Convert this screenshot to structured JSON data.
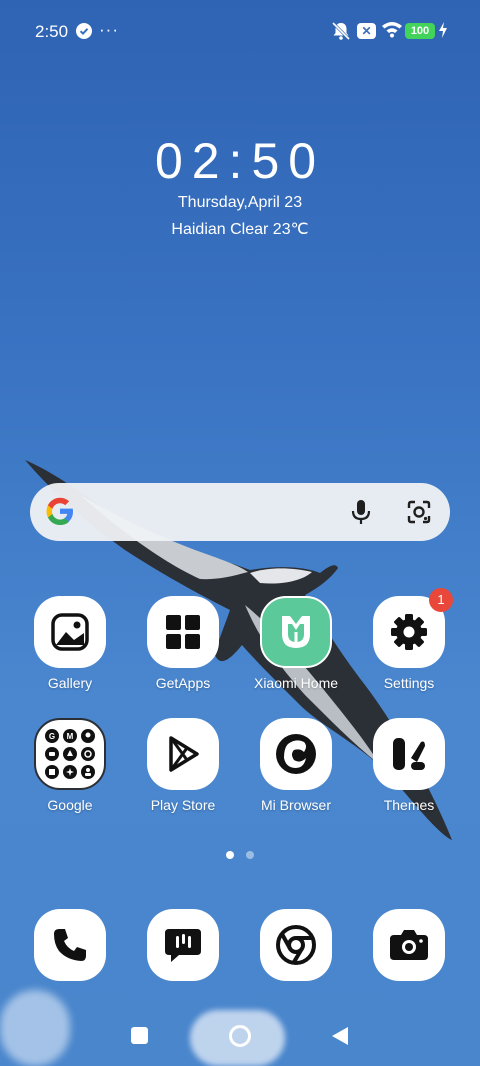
{
  "status_bar": {
    "time": "2:50",
    "more": "···",
    "sim_badge": "✕",
    "battery": "100"
  },
  "clock": {
    "time": "02:50",
    "date": "Thursday,April 23",
    "weather": "Haidian Clear 23℃"
  },
  "search": {
    "icons": [
      "google-logo",
      "mic-icon",
      "lens-icon"
    ]
  },
  "apps": [
    {
      "label": "Gallery",
      "icon": "gallery-icon"
    },
    {
      "label": "GetApps",
      "icon": "getapps-icon"
    },
    {
      "label": "Xiaomi Home",
      "icon": "xiaomi-home-icon"
    },
    {
      "label": "Settings",
      "icon": "gear-icon",
      "badge": "1"
    },
    {
      "label": "Google",
      "icon": "google-folder-icon"
    },
    {
      "label": "Play Store",
      "icon": "play-store-icon"
    },
    {
      "label": "Mi Browser",
      "icon": "mi-browser-icon"
    },
    {
      "label": "Themes",
      "icon": "themes-icon"
    }
  ],
  "dock": [
    {
      "icon": "phone-icon"
    },
    {
      "icon": "messages-icon"
    },
    {
      "icon": "chrome-icon"
    },
    {
      "icon": "camera-icon"
    }
  ],
  "colors": {
    "wallpaper_top": "#2f63b3",
    "wallpaper_bottom": "#4a86cc",
    "badge": "#e9473a",
    "battery": "#43d35b",
    "xiaomi_home": "#5cc99a"
  },
  "page_indicator": {
    "current": 1,
    "total": 2
  }
}
